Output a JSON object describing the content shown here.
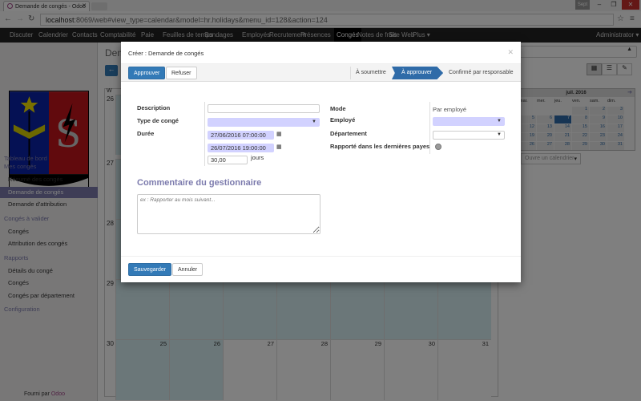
{
  "browser": {
    "tab_title": "Demande de congés - Odoo",
    "url_host": "localhost",
    "url_rest": ":8069/web#view_type=calendar&model=hr.holidays&menu_id=128&action=124",
    "user_badge": "Sept"
  },
  "topnav": {
    "items": [
      "Discuter",
      "Calendrier",
      "Contacts",
      "Comptabilité",
      "Paie",
      "Feuilles de temps",
      "Sondages",
      "Employés",
      "Recrutement",
      "Présences",
      "Congés",
      "Notes de frais",
      "Site Web",
      "Plus ▾"
    ],
    "active": "Congés",
    "user": "Administrator ▾"
  },
  "sidebar": {
    "sections": [
      {
        "title": "Tableau de bord"
      },
      {
        "title": "Mes congés",
        "items": [
          "Résumé des congés",
          "Demande de congés",
          "Demande d'attribution"
        ]
      },
      {
        "title": "Congés à valider",
        "items": [
          "Congés",
          "Attribution des congés"
        ]
      },
      {
        "title": "Rapports",
        "items": [
          "Détails du congé",
          "Congés",
          "Congés par département"
        ]
      },
      {
        "title": "Configuration"
      }
    ],
    "active": "Demande de congés",
    "footer_prefix": "Fourni par ",
    "footer_brand": "Odoo"
  },
  "main": {
    "title": "Demande de congés",
    "week_header": "W",
    "weeks": [
      "26",
      "27",
      "28",
      "29",
      "30"
    ],
    "last_row_days": [
      "25",
      "26",
      "27",
      "28",
      "29",
      "30",
      "31"
    ]
  },
  "minical": {
    "title": "juil. 2016",
    "weekdays": [
      "mar.",
      "mer.",
      "jeu.",
      "ven.",
      "sam.",
      "dim."
    ],
    "rows": [
      [
        "",
        "",
        "",
        "1",
        "2",
        "3"
      ],
      [
        "5",
        "6",
        "7",
        "8",
        "9",
        "10"
      ],
      [
        "12",
        "13",
        "14",
        "15",
        "16",
        "17"
      ],
      [
        "19",
        "20",
        "21",
        "22",
        "23",
        "24"
      ],
      [
        "26",
        "27",
        "28",
        "29",
        "30",
        "31"
      ]
    ],
    "selected": "7",
    "calendar_select": "Ouvre un calendrier"
  },
  "modal": {
    "title": "Créer : Demande de congés",
    "approve": "Approuver",
    "refuse": "Refuser",
    "stages": [
      "À soumettre",
      "À approuver",
      "Confirmé par responsable"
    ],
    "current_stage": "À approuver",
    "fields": {
      "description_label": "Description",
      "description_value": "",
      "type_label": "Type de congé",
      "duration_label": "Durée",
      "date_from": "27/06/2016 07:00:00",
      "date_to": "26/07/2016 19:00:00",
      "days": "30,00",
      "days_unit": "jours",
      "mode_label": "Mode",
      "mode_value": "Par employé",
      "employee_label": "Employé",
      "department_label": "Département",
      "reported_label": "Rapporté dans les dernières payes"
    },
    "comment_title": "Commentaire du gestionnaire",
    "comment_placeholder": "ex : Rapporter au mois suivant...",
    "save": "Sauvegarder",
    "cancel": "Annuler"
  }
}
